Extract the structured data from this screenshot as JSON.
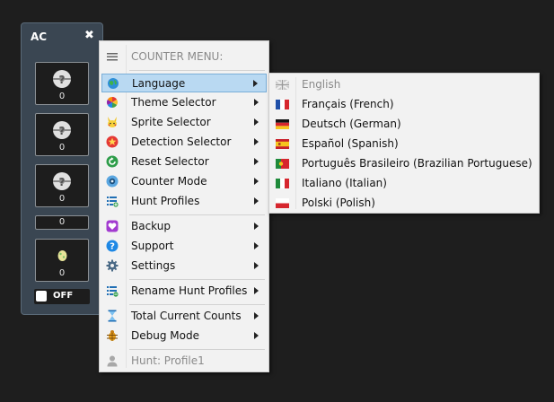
{
  "widget": {
    "title": "AC",
    "close_glyph": "✖",
    "slots": [
      {
        "icon": "unknown-pokemon-icon",
        "count": "0"
      },
      {
        "icon": "unknown-pokemon-icon",
        "count": "0"
      },
      {
        "icon": "unknown-pokemon-icon",
        "count": "0"
      }
    ],
    "plain_count": "0",
    "egg_slot": {
      "icon": "egg-icon",
      "count": "0"
    },
    "toggle_label": "OFF"
  },
  "menu": {
    "header": "COUNTER MENU:",
    "items": [
      {
        "label": "Language",
        "icon": "globe-icon",
        "submenu": true
      },
      {
        "label": "Theme Selector",
        "icon": "color-wheel-icon",
        "submenu": true
      },
      {
        "label": "Sprite Selector",
        "icon": "pikachu-icon",
        "submenu": true
      },
      {
        "label": "Detection Selector",
        "icon": "star-badge-icon",
        "submenu": true
      },
      {
        "label": "Reset Selector",
        "icon": "reset-icon",
        "submenu": true
      },
      {
        "label": "Counter Mode",
        "icon": "eye-icon",
        "submenu": true
      },
      {
        "label": "Hunt Profiles",
        "icon": "list-add-icon",
        "submenu": true
      },
      {
        "label": "Backup",
        "icon": "heart-icon",
        "submenu": true
      },
      {
        "label": "Support",
        "icon": "help-icon",
        "submenu": true
      },
      {
        "label": "Settings",
        "icon": "gear-icon",
        "submenu": true
      },
      {
        "label": "Rename Hunt Profiles",
        "icon": "list-edit-icon",
        "submenu": true
      },
      {
        "label": "Total Current Counts",
        "icon": "hourglass-icon",
        "submenu": true
      },
      {
        "label": "Debug Mode",
        "icon": "bug-icon",
        "submenu": true
      }
    ],
    "footer": "Hunt: Profile1"
  },
  "language_menu": {
    "items": [
      {
        "label": "English",
        "flag": "uk-flag-icon",
        "disabled": true
      },
      {
        "label": "Français (French)",
        "flag": "france-flag-icon"
      },
      {
        "label": "Deutsch (German)",
        "flag": "germany-flag-icon"
      },
      {
        "label": "Español (Spanish)",
        "flag": "spain-flag-icon"
      },
      {
        "label": "Português Brasileiro (Brazilian Portuguese)",
        "flag": "portugal-flag-icon"
      },
      {
        "label": "Italiano (Italian)",
        "flag": "italy-flag-icon"
      },
      {
        "label": "Polski (Polish)",
        "flag": "poland-flag-icon"
      }
    ]
  },
  "colors": {
    "highlight": "#b9d9f2",
    "menu_bg": "#f2f2f2",
    "widget_bg": "#3a4652",
    "page_bg": "#1e1e1e"
  }
}
